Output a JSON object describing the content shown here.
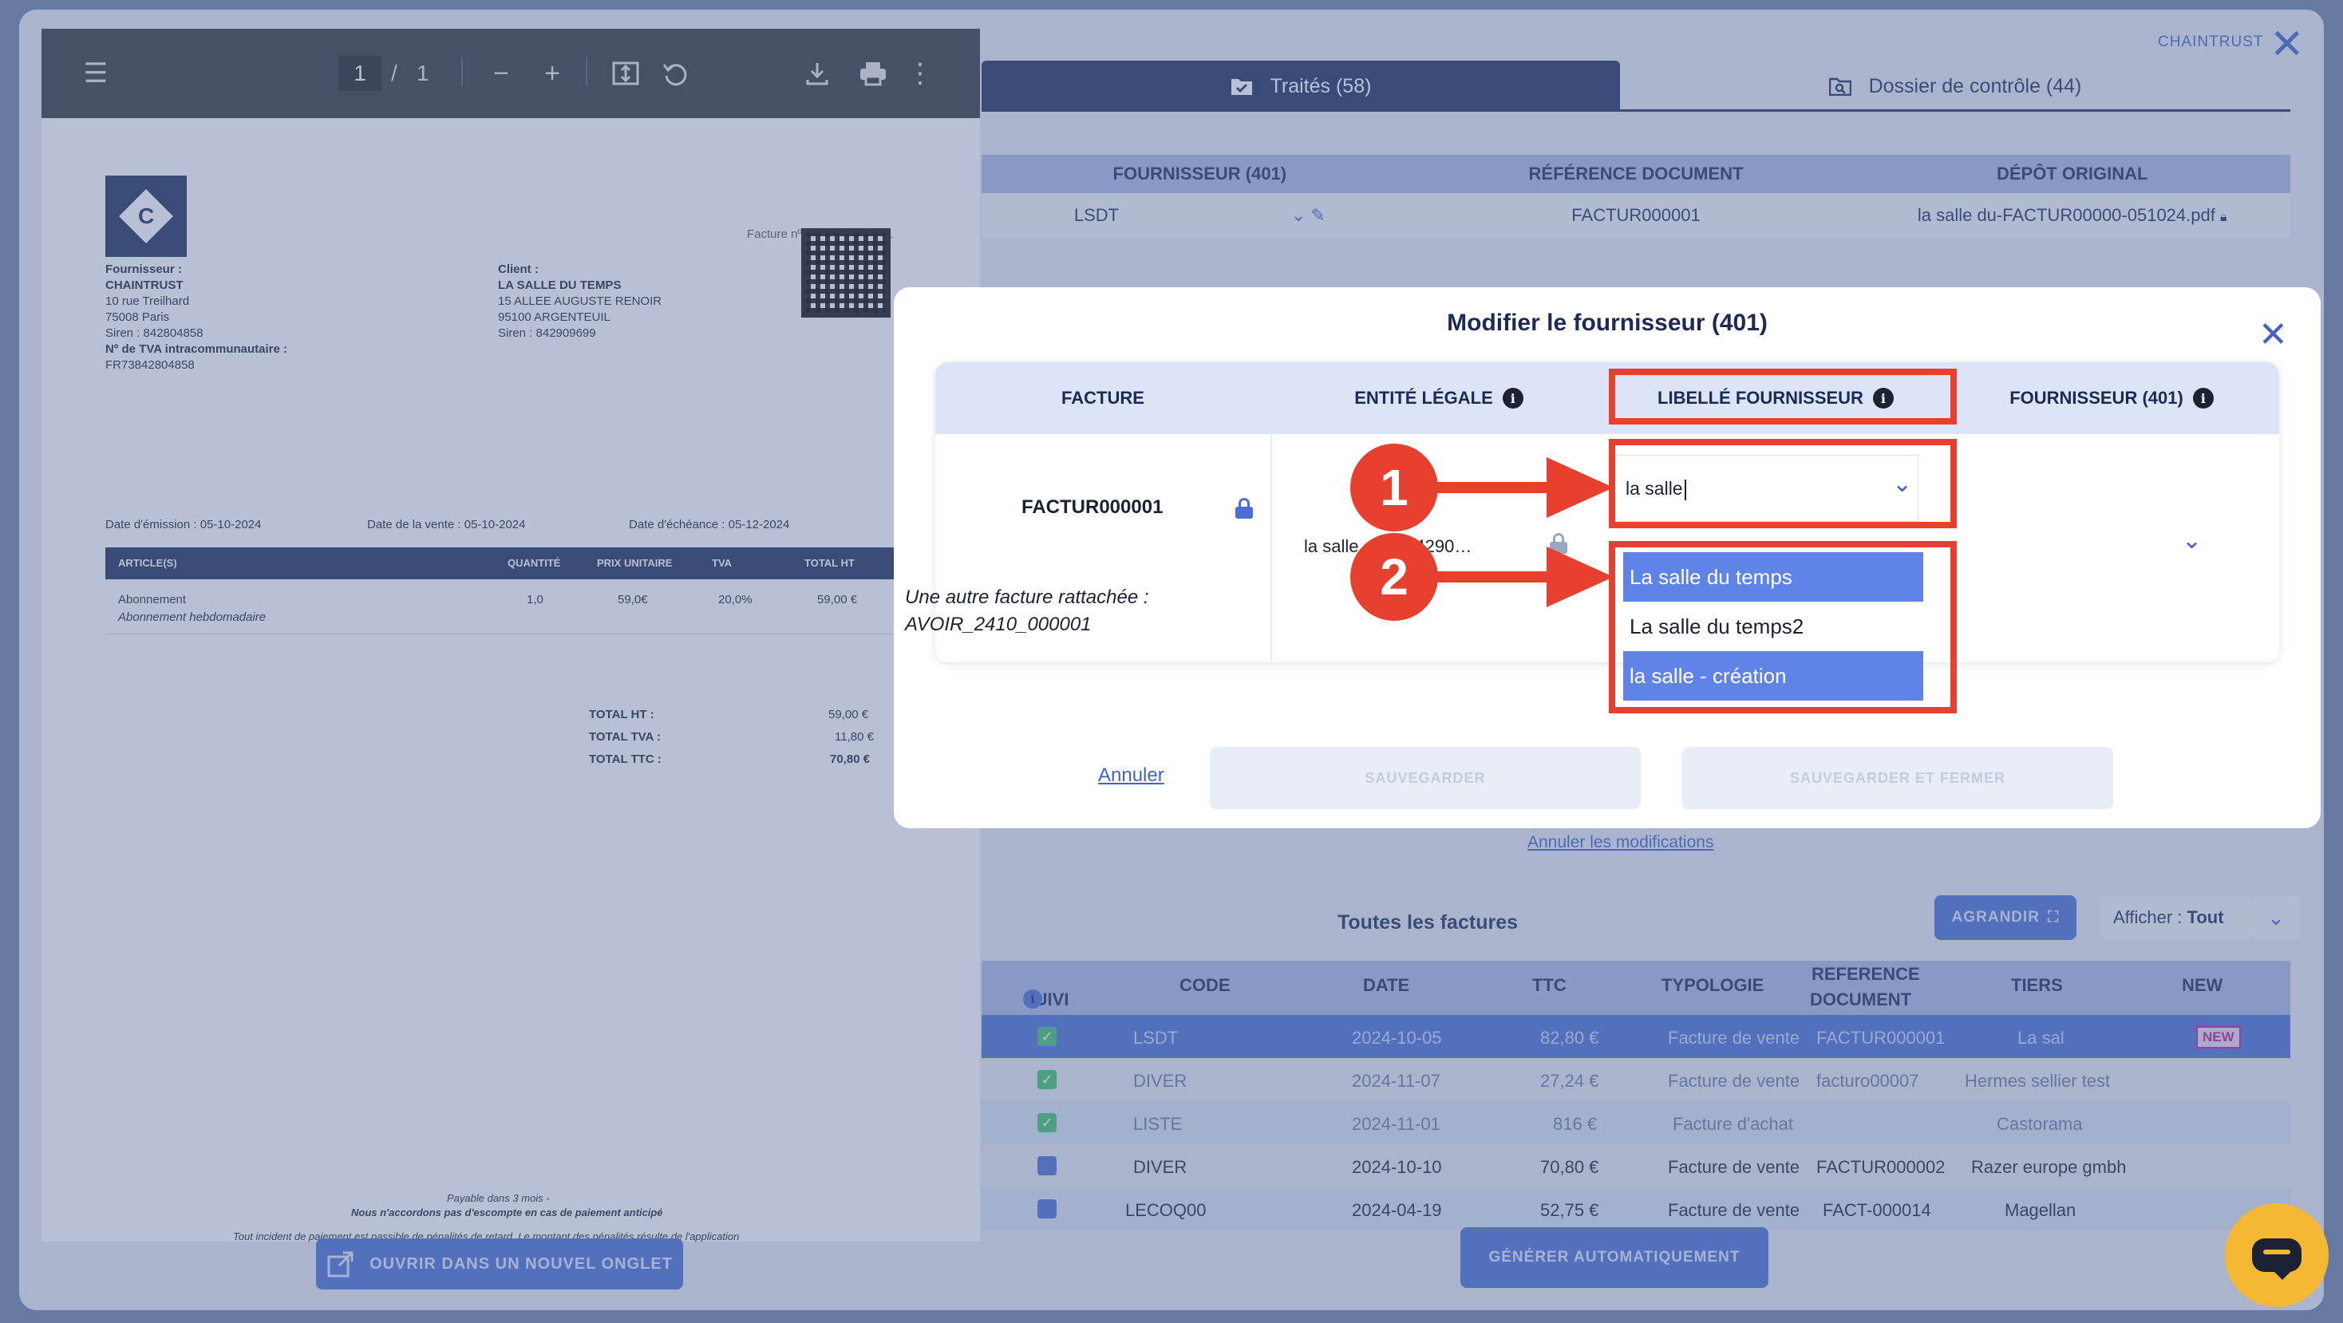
{
  "pdf": {
    "page_current": "1",
    "page_sep": "/",
    "page_total": "1",
    "invoice_ref": "Facture nº FACTUR000001",
    "supplier_label": "Fournisseur :",
    "supplier_name": "CHAINTRUST",
    "supplier_addr1": "10 rue Treilhard",
    "supplier_addr2": "75008 Paris",
    "supplier_siren": "Siren : 842804858",
    "supplier_tva_label": "Nº de TVA intracommunautaire :",
    "supplier_tva": "FR73842804858",
    "client_label": "Client :",
    "client_name": "LA SALLE DU TEMPS",
    "client_addr1": "15 ALLEE AUGUSTE RENOIR",
    "client_addr2": "95100 ARGENTEUIL",
    "client_siren": "Siren : 842909699",
    "date_emission": "Date d'émission : 05-10-2024",
    "date_vente": "Date de la vente : 05-10-2024",
    "date_echeance": "Date d'échéance : 05-12-2024",
    "table_cols": [
      "ARTICLE(S)",
      "QUANTITÉ",
      "PRIX UNITAIRE",
      "TVA",
      "TOTAL HT"
    ],
    "item_name": "Abonnement",
    "item_desc": "Abonnement hebdomadaire",
    "item_qty": "1,0",
    "item_price": "59,0€",
    "item_tva": "20,0%",
    "item_total": "59,00 €",
    "total_ht_label": "TOTAL HT :",
    "total_ht": "59,00 €",
    "total_tva_label": "TOTAL TVA :",
    "total_tva": "11,80 €",
    "total_ttc_label": "TOTAL TTC :",
    "total_ttc": "70,80 €",
    "footer1": "Payable dans 3 mois -",
    "footer2": "Nous n'accordons pas d'escompte en cas de paiement anticipé",
    "footer3": "Tout incident de paiement est passible de pénalités de retard. Le montant des pénalités résulte de l'application",
    "open_tab_label": "OUVRIR DANS UN NOUVEL ONGLET"
  },
  "header": {
    "brand": "CHAINTRUST",
    "tabs": [
      {
        "label": "Traités (58)",
        "icon": "folder-check-icon"
      },
      {
        "label": "Dossier de contrôle (44)",
        "icon": "folder-search-icon"
      }
    ]
  },
  "top_table": {
    "headers": [
      "FOURNISSEUR (401)",
      "RÉFÉRENCE DOCUMENT",
      "DÉPÔT ORIGINAL"
    ],
    "supplier": "LSDT",
    "reference": "FACTUR000001",
    "depot": "la salle du-FACTUR00000-051024.pdf"
  },
  "annuler_modifications": "Annuler les modifications",
  "invoices": {
    "title": "Toutes les factures",
    "agrandir": "AGRANDIR",
    "afficher_label": "Afficher : ",
    "afficher_value": "Tout",
    "headers": [
      "SUIVI",
      "CODE",
      "DATE",
      "TTC",
      "TYPOLOGIE",
      "REFERENCE",
      "DOCUMENT",
      "TIERS",
      "NEW"
    ],
    "rows": [
      {
        "code": "LSDT",
        "date": "2024-10-05",
        "ttc": "82,80 €",
        "typo": "Facture de vente",
        "ref": "FACTUR000001",
        "tiers": "La sal",
        "new": "NEW"
      },
      {
        "code": "DIVER",
        "date": "2024-11-07",
        "ttc": "27,24 €",
        "typo": "Facture de vente",
        "ref": "facturo00007",
        "tiers": "Hermes sellier test",
        "new": ""
      },
      {
        "code": "LISTE",
        "date": "2024-11-01",
        "ttc": "816 €",
        "typo": "Facture d'achat",
        "ref": "",
        "tiers": "Castorama",
        "new": ""
      },
      {
        "code": "DIVER",
        "date": "2024-10-10",
        "ttc": "70,80 €",
        "typo": "Facture de vente",
        "ref": "FACTUR000002",
        "tiers": "Razer europe gmbh",
        "new": ""
      },
      {
        "code": "LECOQ00",
        "date": "2024-04-19",
        "ttc": "52,75 €",
        "typo": "Facture de vente",
        "ref": "FACT-000014",
        "tiers": "Magellan",
        "new": ""
      }
    ],
    "generate_label": "GÉNÉRER AUTOMATIQUEMENT"
  },
  "modal": {
    "title": "Modifier le fournisseur (401)",
    "col_facture": "FACTURE",
    "col_entite": "ENTITÉ LÉGALE",
    "col_libelle": "LIBELLÉ FOURNISSEUR",
    "col_fournisseur": "FOURNISSEUR (401)",
    "info_glyph": "i",
    "facture_num": "FACTUR000001",
    "autre_line1": "Une autre facture rattachée :",
    "autre_line2": "AVOIR_2410_000001",
    "legal_entity": "la salle … s (84290…",
    "combo_value": "la salle",
    "options": [
      "La salle du temps",
      "La salle du temps2",
      "la salle - création"
    ],
    "annuler": "Annuler",
    "sauvegarder": "SAUVEGARDER",
    "sauvegarder_fermer": "SAUVEGARDER ET FERMER",
    "step1": "1",
    "step2": "2"
  },
  "colors": {
    "navy": "#1c2a57",
    "accent": "#4a6ed6",
    "annotation_red": "#e8402f",
    "chat_yellow": "#f5b833"
  }
}
